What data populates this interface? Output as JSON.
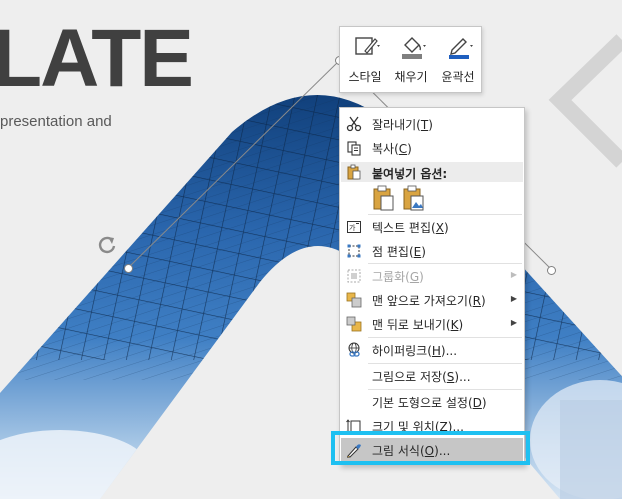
{
  "slide": {
    "title": "LATE",
    "subtitle": "presentation and"
  },
  "mini_toolbar": {
    "buttons": [
      {
        "label": "스타일",
        "icon": "shape-style-icon"
      },
      {
        "label": "채우기",
        "icon": "fill-bucket-icon"
      },
      {
        "label": "윤곽선",
        "icon": "outline-pen-icon"
      }
    ],
    "colors": {
      "fill_accent": "#7f7f7f",
      "outline_accent": "#1f5fbf"
    }
  },
  "context_menu": {
    "items": [
      {
        "label": "잘라내기",
        "key": "T",
        "icon": "scissors-icon"
      },
      {
        "label": "복사",
        "key": "C",
        "icon": "copy-icon"
      },
      {
        "header": "붙여넣기 옵션:",
        "icon": "paste-icon"
      },
      {
        "label": "텍스트 편집",
        "key": "X",
        "icon": "edit-text-icon"
      },
      {
        "label": "점 편집",
        "key": "E",
        "icon": "edit-points-icon"
      },
      {
        "label": "그룹화",
        "key": "G",
        "icon": "group-icon",
        "disabled": true,
        "submenu": true
      },
      {
        "label": "맨 앞으로 가져오기",
        "key": "R",
        "icon": "bring-to-front-icon",
        "submenu": true
      },
      {
        "label": "맨 뒤로 보내기",
        "key": "K",
        "icon": "send-to-back-icon",
        "submenu": true
      },
      {
        "label": "하이퍼링크",
        "key": "H",
        "suffix": "...",
        "icon": "hyperlink-icon"
      },
      {
        "label": "그림으로 저장",
        "key": "S",
        "suffix": "...",
        "icon": ""
      },
      {
        "label": "기본 도형으로 설정",
        "key": "D",
        "icon": ""
      },
      {
        "label": "크기 및 위치",
        "key": "Z",
        "suffix": "...",
        "icon": "size-position-icon"
      },
      {
        "label": "그림 서식",
        "key": "O",
        "suffix": "...",
        "icon": "format-picture-icon",
        "highlighted": true
      }
    ]
  },
  "colors": {
    "highlight_callout": "#1ec0f1",
    "menu_highlight": "#c6c6c6",
    "title_text": "#404040"
  }
}
